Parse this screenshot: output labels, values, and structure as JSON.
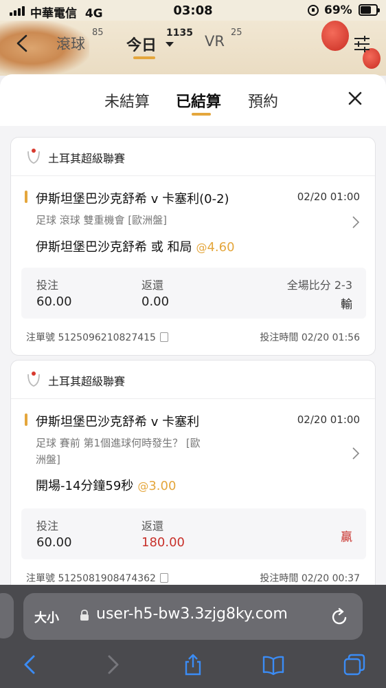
{
  "status_bar": {
    "carrier": "中華電信",
    "network": "4G",
    "time": "03:08",
    "battery": "69%",
    "battery_level": 0.69
  },
  "top_nav": {
    "tabs": [
      {
        "label": "滾球",
        "count": "85"
      },
      {
        "label": "今日",
        "count": "1135"
      },
      {
        "label": "VR",
        "count": "25"
      }
    ]
  },
  "sheet": {
    "tabs": [
      "未結算",
      "已結算",
      "預約"
    ],
    "active_tab": "已結算"
  },
  "bets": [
    {
      "league": "土耳其超級聯賽",
      "match": "伊斯坦堡巴沙克舒希 v 卡塞利(0-2)",
      "match_time": "02/20 01:00",
      "market": "足球  滾球  雙重機會 [歐洲盤]",
      "selection": "伊斯坦堡巴沙克舒希 或 和局",
      "odds": "4.60",
      "stake_label": "投注",
      "stake": "60.00",
      "return_label": "返還",
      "return": "0.00",
      "score_label": "全場比分",
      "score": "2-3",
      "result": "輸",
      "order_label": "注單號",
      "order_no": "5125096210827415",
      "bet_time_label": "投注時間",
      "bet_time": "02/20 01:56"
    },
    {
      "league": "土耳其超級聯賽",
      "match": "伊斯坦堡巴沙克舒希 v 卡塞利",
      "match_time": "02/20 01:00",
      "market_line1": "足球  賽前  第1個進球何時發生？ [歐",
      "market_line2": "洲盤]",
      "selection": "開場-14分鐘59秒",
      "odds": "3.00",
      "stake_label": "投注",
      "stake": "60.00",
      "return_label": "返還",
      "return": "180.00",
      "result": "贏",
      "order_label": "注單號",
      "order_no": "5125081908474362",
      "bet_time_label": "投注時間",
      "bet_time": "02/20 00:37"
    }
  ],
  "browser": {
    "text_size_label": "大小",
    "url": "user-h5-bw3.3zjg8ky.com"
  },
  "colors": {
    "accent": "#e4a63c",
    "win_red": "#c8312b"
  }
}
